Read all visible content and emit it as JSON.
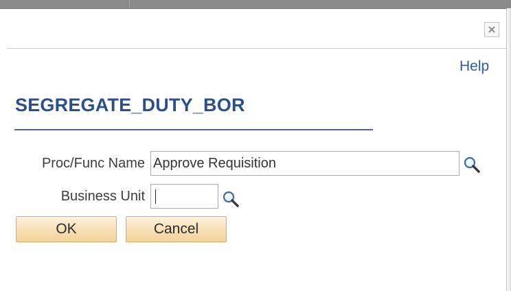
{
  "dialog": {
    "help_label": "Help",
    "title": "SEGREGATE_DUTY_BOR"
  },
  "form": {
    "proc_func_label": "Proc/Func Name",
    "proc_func_value": "Approve Requisition",
    "business_unit_label": "Business Unit",
    "business_unit_value": ""
  },
  "buttons": {
    "ok_label": "OK",
    "cancel_label": "Cancel"
  },
  "icons": {
    "close": "close-icon",
    "lookup": "magnifier-lookup-icon"
  },
  "colors": {
    "title": "#2b4f8a",
    "link": "#2a5ba7",
    "button_fill": "#f8dfb4",
    "button_border": "#d9a96a"
  }
}
